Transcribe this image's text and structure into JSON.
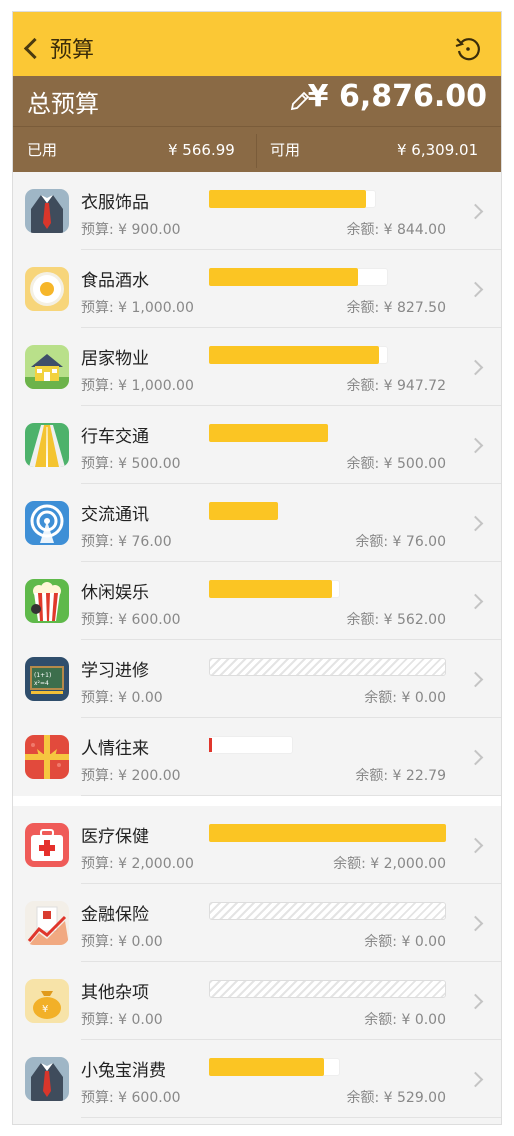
{
  "nav": {
    "title": "预算",
    "back_icon": "chevron-left-icon",
    "refresh_icon": "refresh-icon"
  },
  "summary": {
    "title": "总预算",
    "total_amount": "¥ 6,876.00",
    "used_label": "已用",
    "used_value": "¥ 566.99",
    "available_label": "可用",
    "available_value": "¥ 6,309.01",
    "edit_icon": "pencil-icon"
  },
  "colors": {
    "accent": "#fbc835",
    "summary_bg": "#8a6a45",
    "bar_fill": "#fbc523",
    "over_marker": "#e0362c"
  },
  "categories": [
    {
      "name": "衣服饰品",
      "budget": "预算: ¥ 900.00",
      "remain": "余额: ¥ 844.00",
      "icon": "suit-tie-icon",
      "fraction": 0.94
    },
    {
      "name": "食品酒水",
      "budget": "预算: ¥ 1,000.00",
      "remain": "余额: ¥ 827.50",
      "icon": "fried-egg-icon",
      "fraction": 0.83
    },
    {
      "name": "居家物业",
      "budget": "预算: ¥ 1,000.00",
      "remain": "余额: ¥ 947.72",
      "icon": "house-icon",
      "fraction": 0.95
    },
    {
      "name": "行车交通",
      "budget": "预算: ¥ 500.00",
      "remain": "余额: ¥ 500.00",
      "icon": "road-icon",
      "fraction": 1.0
    },
    {
      "name": "交流通讯",
      "budget": "预算: ¥ 76.00",
      "remain": "余额: ¥ 76.00",
      "icon": "signal-tower-icon",
      "fraction": 1.0
    },
    {
      "name": "休闲娱乐",
      "budget": "预算: ¥ 600.00",
      "remain": "余额: ¥ 562.00",
      "icon": "popcorn-icon",
      "fraction": 0.94
    },
    {
      "name": "学习进修",
      "budget": "预算: ¥ 0.00",
      "remain": "余额: ¥ 0.00",
      "icon": "chalkboard-icon",
      "fraction": null
    },
    {
      "name": "人情往来",
      "budget": "预算: ¥ 200.00",
      "remain": "余额: ¥ 22.79",
      "icon": "gift-box-icon",
      "fraction": 0.11
    },
    {
      "name": "医疗保健",
      "budget": "预算: ¥ 2,000.00",
      "remain": "余额: ¥ 2,000.00",
      "icon": "first-aid-kit-icon",
      "fraction": 1.0
    },
    {
      "name": "金融保险",
      "budget": "预算: ¥ 0.00",
      "remain": "余额: ¥ 0.00",
      "icon": "finance-chart-icon",
      "fraction": null
    },
    {
      "name": "其他杂项",
      "budget": "预算: ¥ 0.00",
      "remain": "余额: ¥ 0.00",
      "icon": "money-bag-icon",
      "fraction": null
    },
    {
      "name": "小兔宝消费",
      "budget": "预算: ¥ 600.00",
      "remain": "余额: ¥ 529.00",
      "icon": "suit-tie-icon",
      "fraction": 0.88
    }
  ]
}
